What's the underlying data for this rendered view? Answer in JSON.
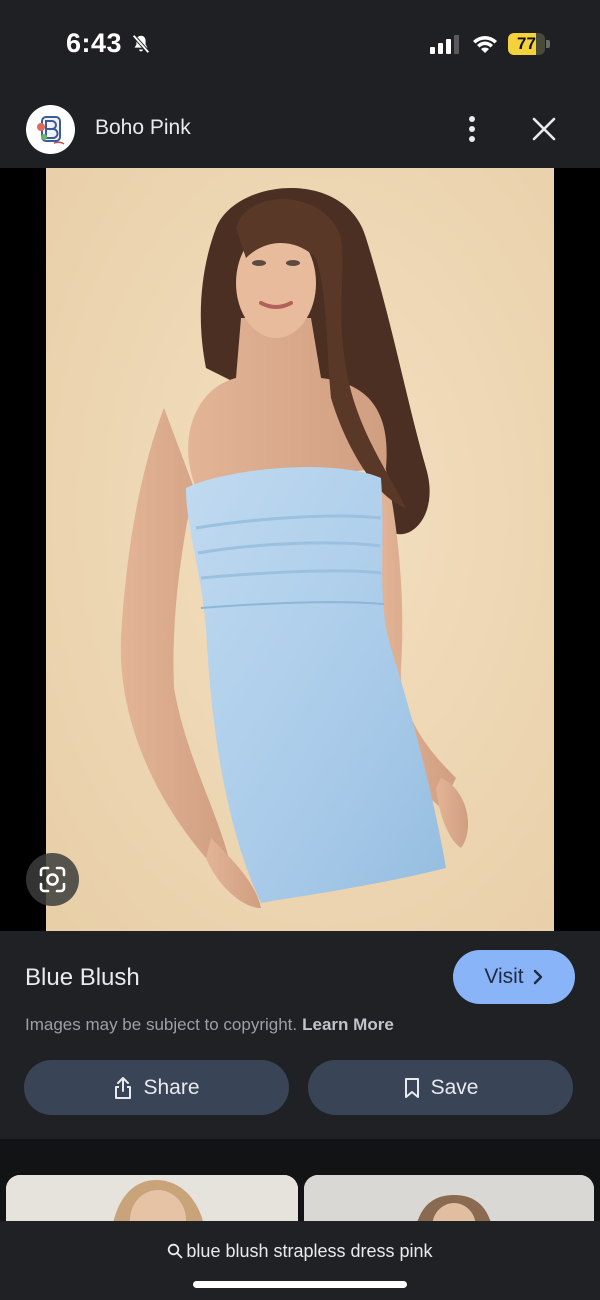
{
  "status_bar": {
    "time": "6:43",
    "battery": "77",
    "battery_level": 0.77
  },
  "header": {
    "site_name": "Boho Pink"
  },
  "result": {
    "title": "Blue Blush",
    "visit_label": "Visit",
    "copyright_text": "Images may be subject to copyright.",
    "learn_more_label": "Learn More",
    "share_label": "Share",
    "save_label": "Save"
  },
  "search": {
    "query": "blue blush strapless dress pink"
  },
  "colors": {
    "accent": "#8ab4f8",
    "pill_bg": "#394457",
    "panel_bg": "#202124",
    "battery": "#f4d23c"
  }
}
